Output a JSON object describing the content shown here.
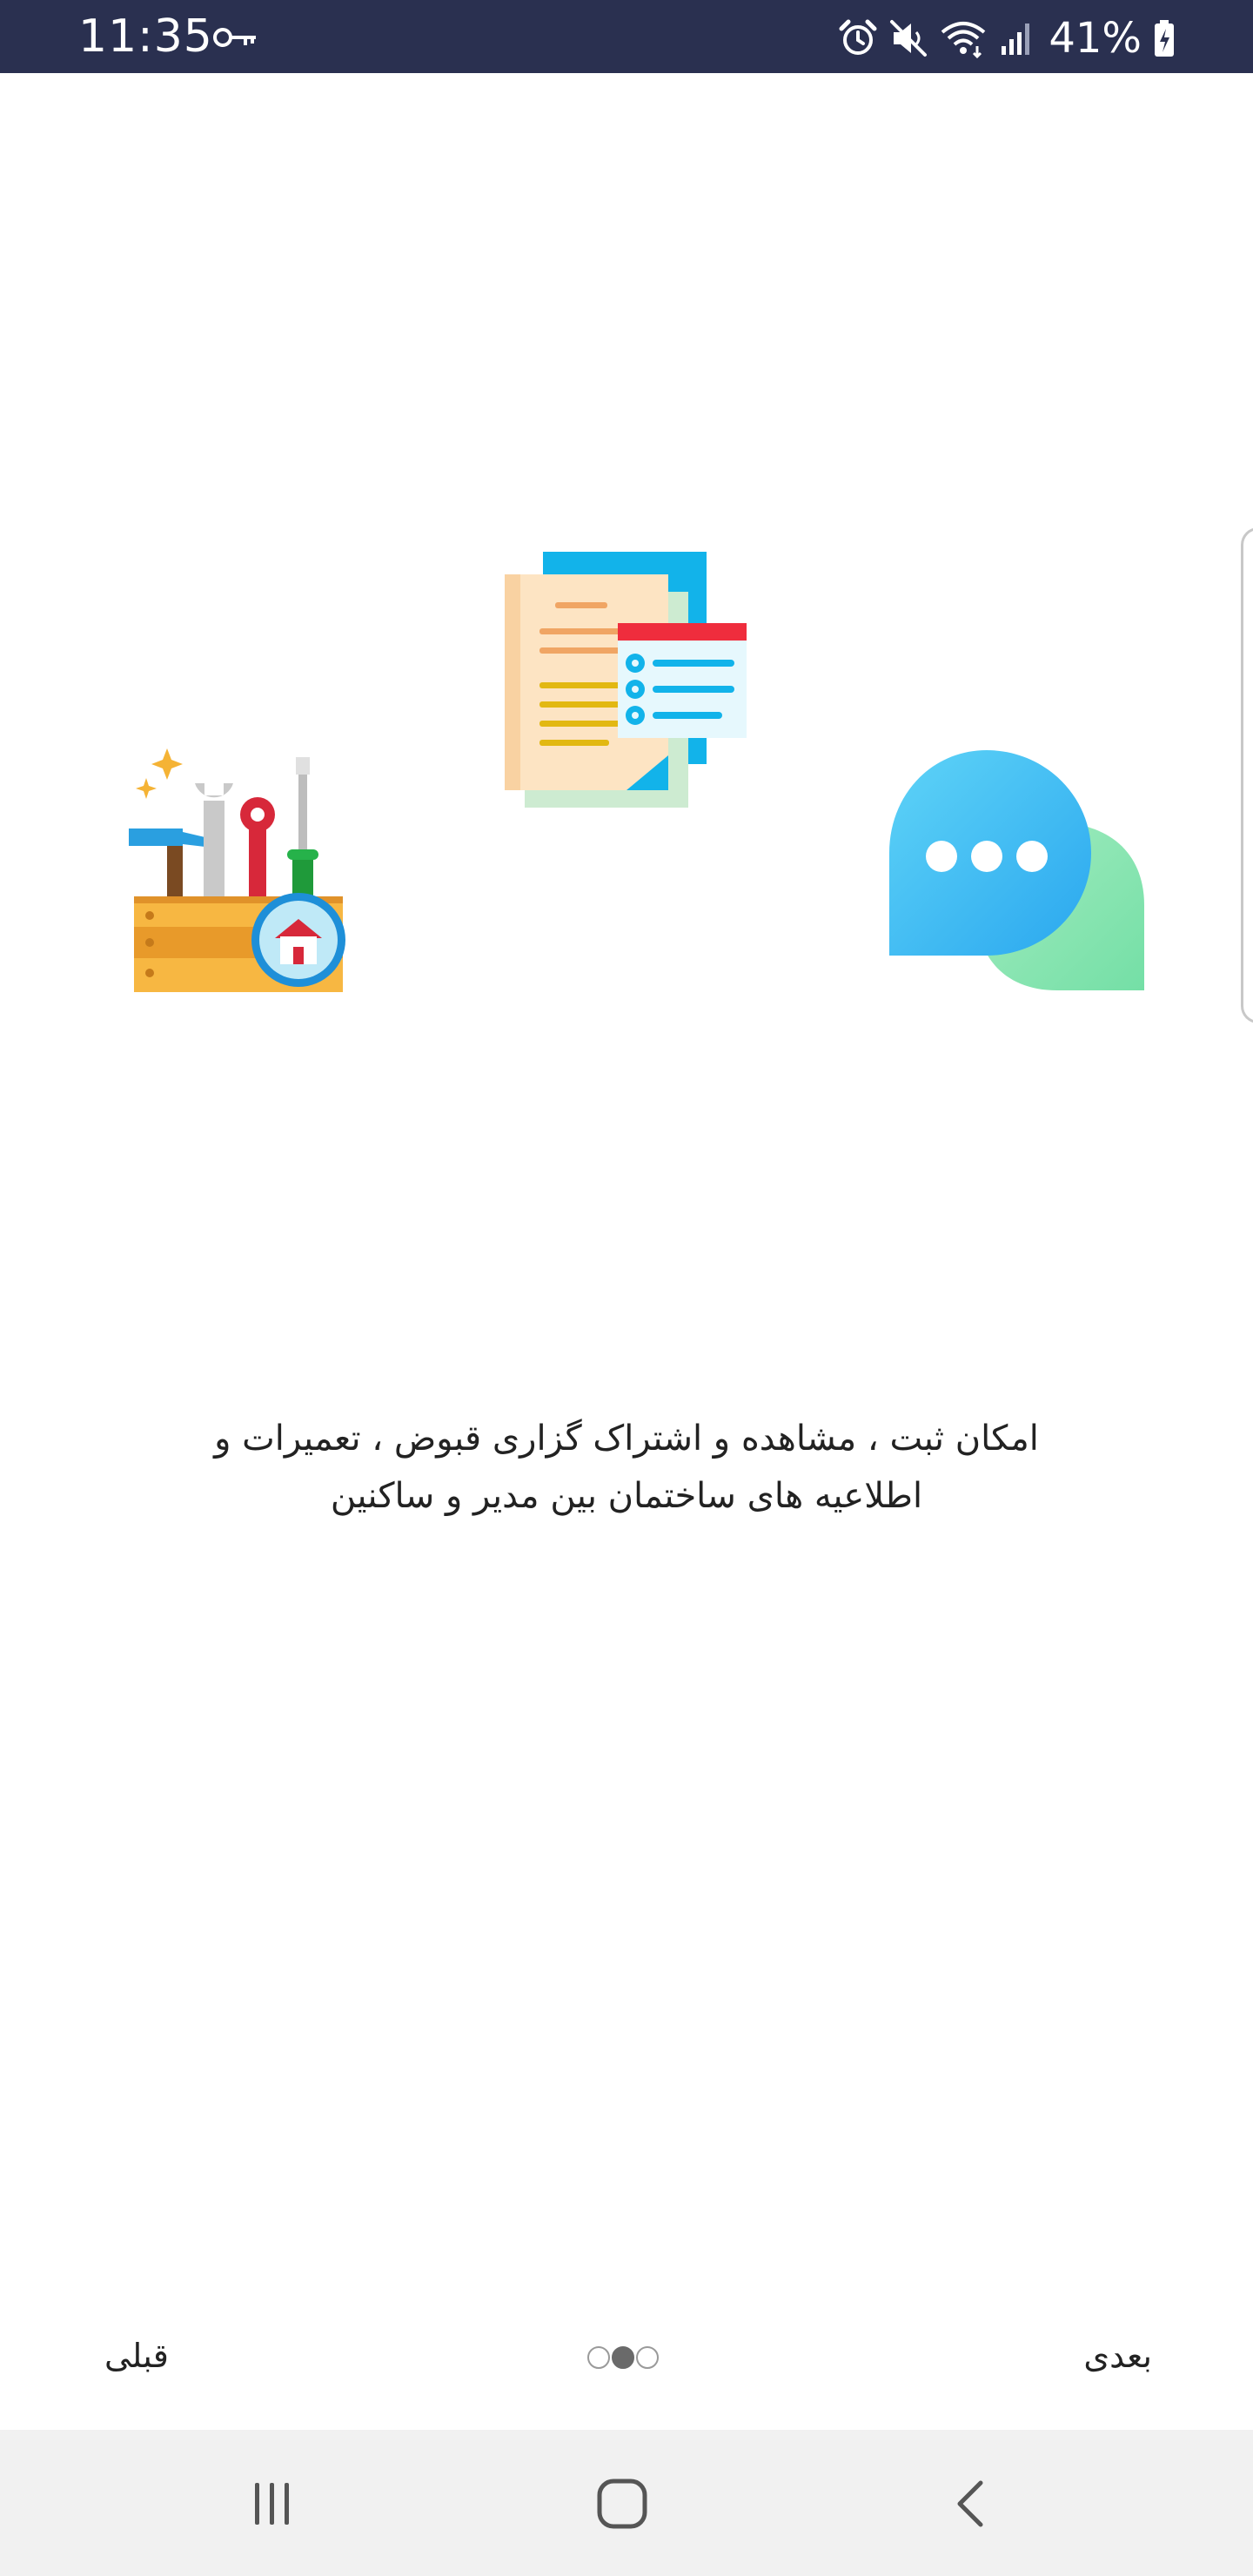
{
  "status_bar": {
    "time": "11:35",
    "battery": "41%",
    "icons": [
      "key-icon",
      "alarm-icon",
      "mute-icon",
      "wifi-icon",
      "signal-icon",
      "battery-charging-icon"
    ]
  },
  "illustrations": [
    "toolbox-illustration",
    "documents-illustration",
    "chat-bubbles-illustration"
  ],
  "onboarding": {
    "description_line1": "امکان ثبت ، مشاهده و اشتراک گزاری قبوض ، تعمیرات و",
    "description_line2": "اطلاعیه های ساختمان بین مدیر و ساکنین"
  },
  "footer": {
    "prev_label": "قبلی",
    "next_label": "بعدی",
    "page_count": 3,
    "current_page": 2
  },
  "nav_bar": {
    "icons": [
      "recents-icon",
      "home-icon",
      "back-icon"
    ]
  },
  "colors": {
    "status_bar_bg": "#2a3050",
    "nav_bar_bg": "#f1f1f1",
    "dot_active": "#6a6a6a"
  }
}
